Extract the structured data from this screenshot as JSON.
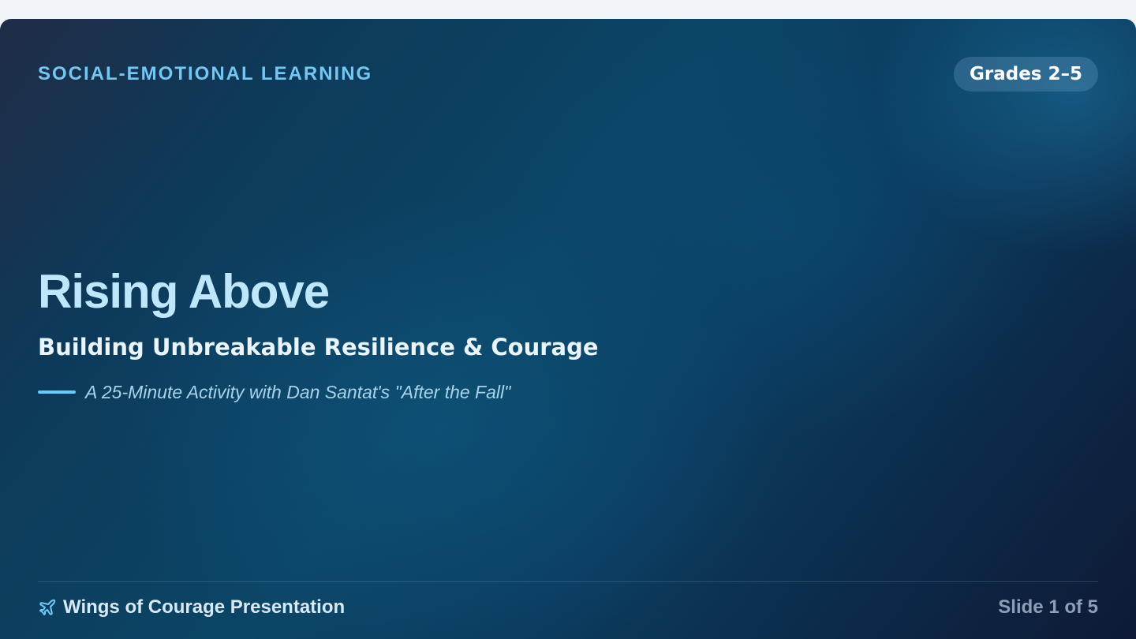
{
  "slide": {
    "category": "SOCIAL-EMOTIONAL LEARNING",
    "grade_badge": "Grades 2–5",
    "title": "Rising Above",
    "subtitle": "Building Unbreakable Resilience & Courage",
    "tagline": "A 25-Minute Activity with Dan Santat's \"After the Fall\""
  },
  "footer": {
    "icon": "plane-icon",
    "presentation_name": "Wings of Courage Presentation",
    "slide_counter": "Slide 1 of 5"
  },
  "colors": {
    "accent": "#74c7f2",
    "title": "#bfe7fb",
    "background_dark": "#0c3a5c"
  }
}
